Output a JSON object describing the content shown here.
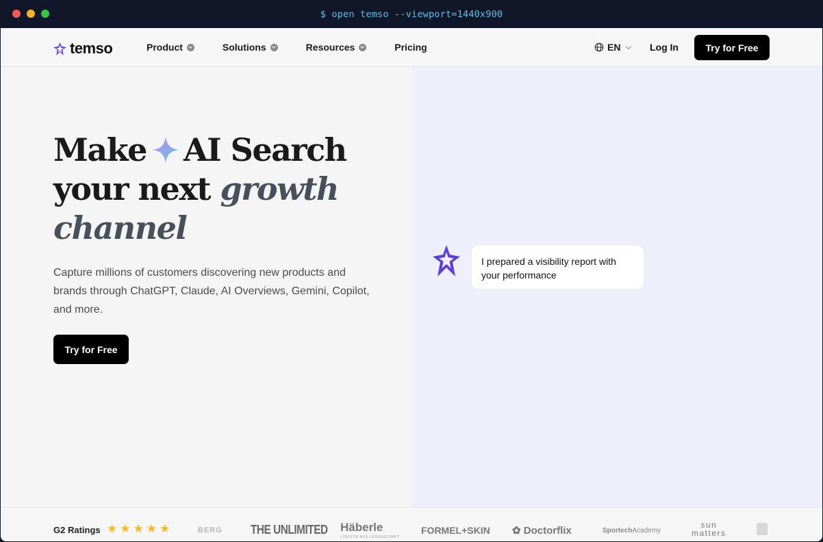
{
  "terminal": {
    "command": "$ open temso --viewport=1440x900"
  },
  "nav": {
    "logo_text": "temso",
    "menu": [
      {
        "label": "Product",
        "has_dropdown": true
      },
      {
        "label": "Solutions",
        "has_dropdown": true
      },
      {
        "label": "Resources",
        "has_dropdown": true
      },
      {
        "label": "Pricing",
        "has_dropdown": false
      }
    ],
    "language": "EN",
    "login": "Log In",
    "cta": "Try for Free"
  },
  "hero": {
    "headline_part1": "Make",
    "headline_part2": "AI Search",
    "headline_part3": "your next",
    "headline_italic1": "growth",
    "headline_italic2": "channel",
    "subtext": "Capture millions of customers discovering new products and brands through ChatGPT, Claude, AI Overviews, Gemini, Copilot, and more.",
    "cta": "Try for Free",
    "chat_message": "I prepared a visibility report with your performance"
  },
  "ratings": {
    "label": "G2 Ratings",
    "stars": 5
  },
  "brands": [
    "BERG",
    "THE UNLIMITED",
    "Häberle",
    "LOGISTIK AUS LEIDENSCHAFT",
    "FORMEL+SKIN",
    "Doctorflix",
    "Sportech",
    "Academy",
    "sun",
    "matters"
  ],
  "colors": {
    "accent": "#5b3fd6",
    "cta_bg": "#000000",
    "hero_right_bg": "#efeefb",
    "star": "#f5b921"
  }
}
